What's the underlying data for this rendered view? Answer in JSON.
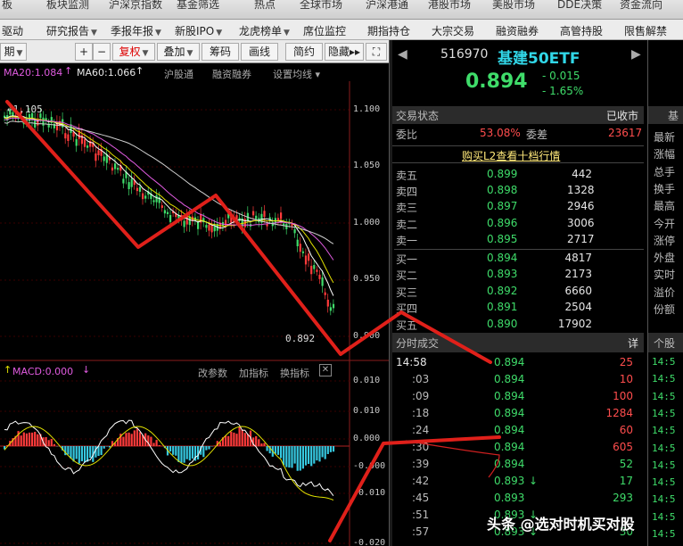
{
  "menu_row1": [
    "板",
    "板块监测",
    "沪深京指数",
    "基金筛选",
    "热点",
    "全球市场",
    "沪深港通",
    "港股市场",
    "美股市场",
    "DDE决策",
    "资金流向"
  ],
  "menu_row2": [
    "驱动",
    "研究报告",
    "季报年报",
    "新股IPO",
    "龙虎榜单",
    "席位监控",
    "期指持仓",
    "大宗交易",
    "融资融券",
    "高管持股",
    "限售解禁"
  ],
  "toolbar": {
    "period": "期",
    "plus": "+",
    "minus": "−",
    "fuquan": "复权",
    "overlay": "叠加",
    "chips": "筹码",
    "draw_line": "画线",
    "simple": "简约",
    "hide": "隐藏",
    "expand_icon": "fullscreen-icon"
  },
  "ma_legend": {
    "ma20": "MA20:1.084",
    "ma60": "MA60:1.066",
    "tab_sh": "沪股通",
    "tab_margin": "融资融券",
    "tab_settings": "设置均线"
  },
  "price_axis": [
    "1.100",
    "1.050",
    "1.000",
    "0.950",
    "0.900"
  ],
  "price_high_label": "1.105",
  "price_last_label": "0.892",
  "macd_legend": {
    "macd": "MACD:0.000",
    "change_params": "改参数",
    "add_indicator": "加指标",
    "switch_indicator": "换指标"
  },
  "macd_axis": [
    "0.010",
    "0.010",
    "0.000",
    "-0.000",
    "-0.010",
    "-0.020"
  ],
  "quote_header": {
    "code": "516970",
    "name": "基建50ETF",
    "price": "0.894",
    "change": "- 0.015",
    "change_pct": "- 1.65%"
  },
  "trade_status": {
    "label": "交易状态",
    "value": "已收市"
  },
  "weibi": {
    "label": "委比",
    "value": "53.08%",
    "diff_label": "委差",
    "diff_value": "23617"
  },
  "l2_link": "购买L2查看十档行情",
  "asks": [
    {
      "label": "卖五",
      "price": "0.899",
      "vol": "442"
    },
    {
      "label": "卖四",
      "price": "0.898",
      "vol": "1328"
    },
    {
      "label": "卖三",
      "price": "0.897",
      "vol": "2946"
    },
    {
      "label": "卖二",
      "price": "0.896",
      "vol": "3006"
    },
    {
      "label": "卖一",
      "price": "0.895",
      "vol": "2717"
    }
  ],
  "bids": [
    {
      "label": "买一",
      "price": "0.894",
      "vol": "4817"
    },
    {
      "label": "买二",
      "price": "0.893",
      "vol": "2173"
    },
    {
      "label": "买三",
      "price": "0.892",
      "vol": "6660"
    },
    {
      "label": "买四",
      "price": "0.891",
      "vol": "2504"
    },
    {
      "label": "买五",
      "price": "0.890",
      "vol": "17902"
    }
  ],
  "ticks_header": {
    "title": "分时成交",
    "detail": "详"
  },
  "ticks": [
    {
      "time": "14:58",
      "price": "0.894",
      "vol": "25",
      "arrow": ""
    },
    {
      "time": ":03",
      "price": "0.894",
      "vol": "10",
      "arrow": ""
    },
    {
      "time": ":09",
      "price": "0.894",
      "vol": "100",
      "arrow": ""
    },
    {
      "time": ":18",
      "price": "0.894",
      "vol": "1284",
      "arrow": ""
    },
    {
      "time": ":24",
      "price": "0.894",
      "vol": "60",
      "arrow": ""
    },
    {
      "time": ":30",
      "price": "0.894",
      "vol": "605",
      "arrow": ""
    },
    {
      "time": ":39",
      "price": "0.894",
      "vol": "52",
      "arrow": ""
    },
    {
      "time": ":42",
      "price": "0.893",
      "vol": "17",
      "arrow": "↓"
    },
    {
      "time": ":45",
      "price": "0.893",
      "vol": "293",
      "arrow": ""
    },
    {
      "time": ":51",
      "price": "0.893",
      "vol": "",
      "arrow": "↓"
    },
    {
      "time": ":57",
      "price": "0.893",
      "vol": "30",
      "arrow": "↓"
    }
  ],
  "side_labels": [
    "最新",
    "涨幅",
    "总手",
    "换手",
    "最高",
    "今开",
    "涨停",
    "外盘",
    "实时",
    "溢价",
    "份额"
  ],
  "side_ticks_header": "个股",
  "side_ticks": [
    "14:5",
    "14:5",
    "14:5",
    "14:5",
    "14:5",
    "14:5",
    "14:5",
    "14:5",
    "14:5",
    "14:5",
    "14:5"
  ],
  "watermark": "头条 @选对时机买对股",
  "colors": {
    "up": "#ff3b3b",
    "down": "#3fdc6a",
    "macd_down": "#36c8e0",
    "annotation": "#e0201a"
  }
}
